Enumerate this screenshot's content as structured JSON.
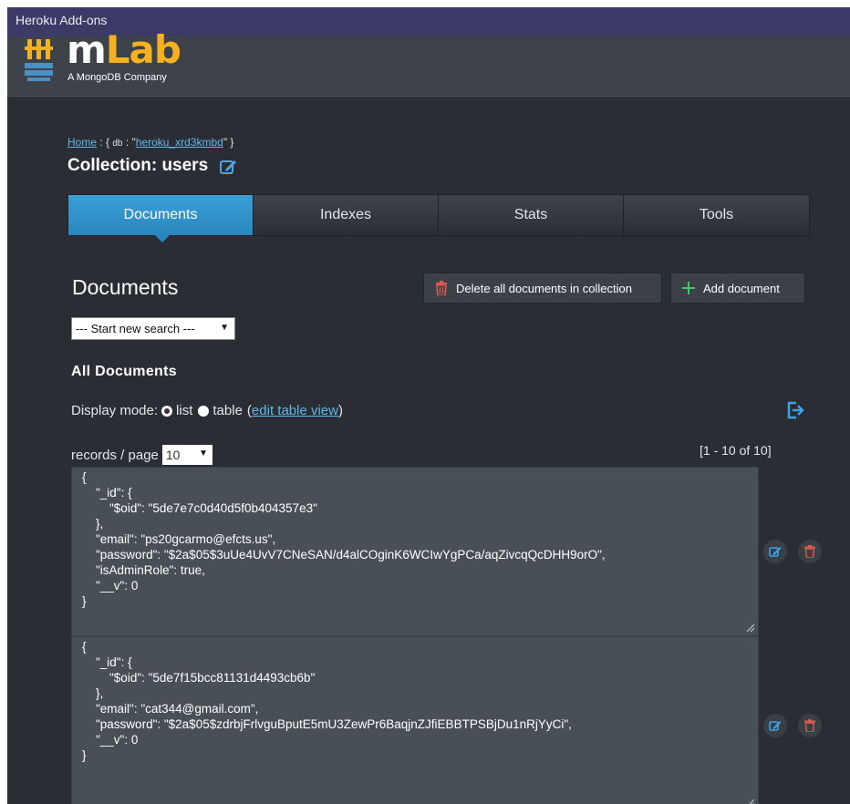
{
  "window_title": "Heroku Add-ons",
  "brand": {
    "logo_m": "m",
    "logo_lab": "Lab",
    "tagline": "A MongoDB Company",
    "logo_icon": "mlab-stack-icon",
    "accent_color": "#f4b120"
  },
  "breadcrumb": {
    "home": "Home",
    "sep1": " : { ",
    "db_key": "db",
    "sep2": " : \"",
    "db_name": "heroku_xrd3kmbd",
    "sep3": "\" }"
  },
  "collection_title": "Collection: users",
  "tabs": [
    {
      "label": "Documents",
      "active": true
    },
    {
      "label": "Indexes",
      "active": false
    },
    {
      "label": "Stats",
      "active": false
    },
    {
      "label": "Tools",
      "active": false
    }
  ],
  "documents": {
    "heading": "Documents",
    "delete_all_label": "Delete all documents in collection",
    "add_label": "Add document",
    "search_select": "--- Start new search ---",
    "all_docs_label": "All Documents",
    "display_mode_label": "Display mode:",
    "mode_list": "list",
    "mode_table": "table",
    "paren_open": "(",
    "edit_table_view": "edit table view",
    "paren_close": ")",
    "records_label": "records / page",
    "per_page": "10",
    "range": "[1 - 10 of 10]"
  },
  "records": [
    {
      "lines": [
        "{",
        "    \"_id\": {",
        "        \"$oid\": \"5de7e7c0d40d5f0b404357e3\"",
        "    },",
        "    \"email\": \"ps20gcarmo@efcts.us\",",
        "    \"password\": \"$2a$05$3uUe4UvV7CNeSAN/d4alCOginK6WCIwYgPCa/aqZivcqQcDHH9orO\",",
        "    \"isAdminRole\": true,",
        "    \"__v\": 0",
        "}"
      ]
    },
    {
      "lines": [
        "{",
        "    \"_id\": {",
        "        \"$oid\": \"5de7f15bcc81131d4493cb6b\"",
        "    },",
        "    \"email\": \"cat344@gmail.com\",",
        "    \"password\": \"$2a$05$zdrbjFrlvguBputE5mU3ZewPr6BaqjnZJfiEBBTPSBjDu1nRjYyCi\",",
        "    \"__v\": 0",
        "}"
      ]
    }
  ],
  "colors": {
    "tab_active": "#2a86bd",
    "link": "#5fb7ea",
    "delete_red": "#e05a4f",
    "add_green": "#4cc26b"
  }
}
